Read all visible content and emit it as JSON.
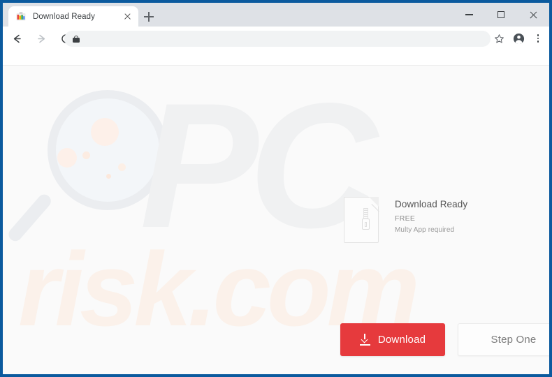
{
  "window": {
    "frame_color": "#0b5a9e",
    "controls": {
      "minimize": "minimize-button",
      "maximize": "maximize-button",
      "close": "close-button"
    }
  },
  "browser": {
    "tab": {
      "title": "Download Ready",
      "favicon": "colorful-app-icon",
      "close_label": "close-tab-icon"
    },
    "new_tab_label": "new-tab-icon",
    "nav": {
      "back": "back-arrow-icon",
      "forward": "forward-arrow-icon",
      "reload": "reload-icon"
    },
    "omnibox": {
      "value": "",
      "placeholder": "",
      "security_icon": "lock-icon"
    },
    "toolbar_right": {
      "bookmark": "star-icon",
      "profile": "account-avatar-icon",
      "menu": "three-dot-menu-icon"
    }
  },
  "page": {
    "background_color": "#fafafa",
    "watermark": {
      "brand_mark": "PC",
      "brand_domain": "risk.com",
      "glass_icon": "magnifying-glass-icon",
      "mark_color": "#f0f1f2",
      "domain_color": "#fbf1ea"
    },
    "file_card": {
      "icon": "zip-file-icon",
      "title": "Download Ready",
      "price": "FREE",
      "note": "Multy App required"
    },
    "buttons": {
      "download": {
        "label": "Download",
        "icon": "download-arrow-icon",
        "color": "#e63a3d",
        "text_color": "#ffffff"
      },
      "step_one": {
        "label": "Step One",
        "color": "#fdfdfd",
        "text_color": "#7c7c7c"
      }
    }
  }
}
